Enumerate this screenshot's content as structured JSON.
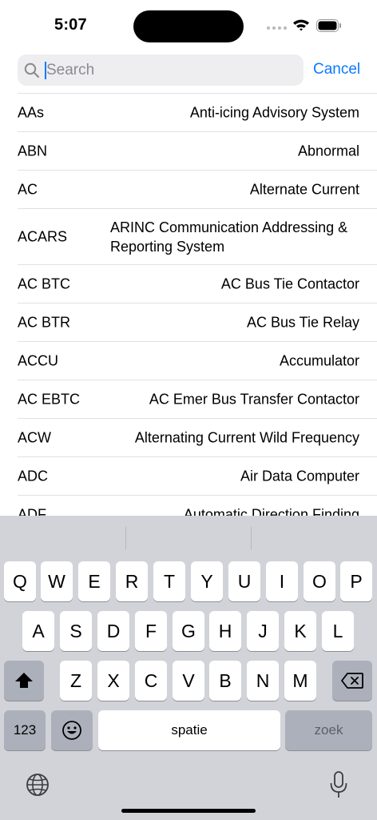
{
  "status_bar": {
    "time": "5:07"
  },
  "search": {
    "placeholder": "Search",
    "value": "",
    "cancel_label": "Cancel"
  },
  "rows": [
    {
      "abbr": "AAs",
      "meaning": "Anti-icing Advisory System"
    },
    {
      "abbr": "ABN",
      "meaning": "Abnormal"
    },
    {
      "abbr": "AC",
      "meaning": "Alternate Current"
    },
    {
      "abbr": "ACARS",
      "meaning": "ARINC Communication Addressing & Reporting System"
    },
    {
      "abbr": "AC BTC",
      "meaning": "AC Bus Tie Contactor"
    },
    {
      "abbr": "AC BTR",
      "meaning": "AC Bus Tie Relay"
    },
    {
      "abbr": "ACCU",
      "meaning": "Accumulator"
    },
    {
      "abbr": "AC EBTC",
      "meaning": "AC Emer Bus Transfer Contactor"
    },
    {
      "abbr": "ACW",
      "meaning": "Alternating Current Wild Frequency"
    },
    {
      "abbr": "ADC",
      "meaning": "Air Data Computer"
    },
    {
      "abbr": "ADF",
      "meaning": "Automatic Direction Finding"
    }
  ],
  "keyboard": {
    "row1": [
      "Q",
      "W",
      "E",
      "R",
      "T",
      "Y",
      "U",
      "I",
      "O",
      "P"
    ],
    "row2": [
      "A",
      "S",
      "D",
      "F",
      "G",
      "H",
      "J",
      "K",
      "L"
    ],
    "row3": [
      "Z",
      "X",
      "C",
      "V",
      "B",
      "N",
      "M"
    ],
    "numbers_label": "123",
    "space_label": "spatie",
    "return_label": "zoek",
    "icons": [
      "shift-icon",
      "backspace-icon",
      "emoji-icon",
      "globe-icon",
      "microphone-icon"
    ]
  },
  "colors": {
    "accent": "#0a7aff",
    "keyboard_bg": "#d1d3d9",
    "separator": "#e1e1e4"
  }
}
